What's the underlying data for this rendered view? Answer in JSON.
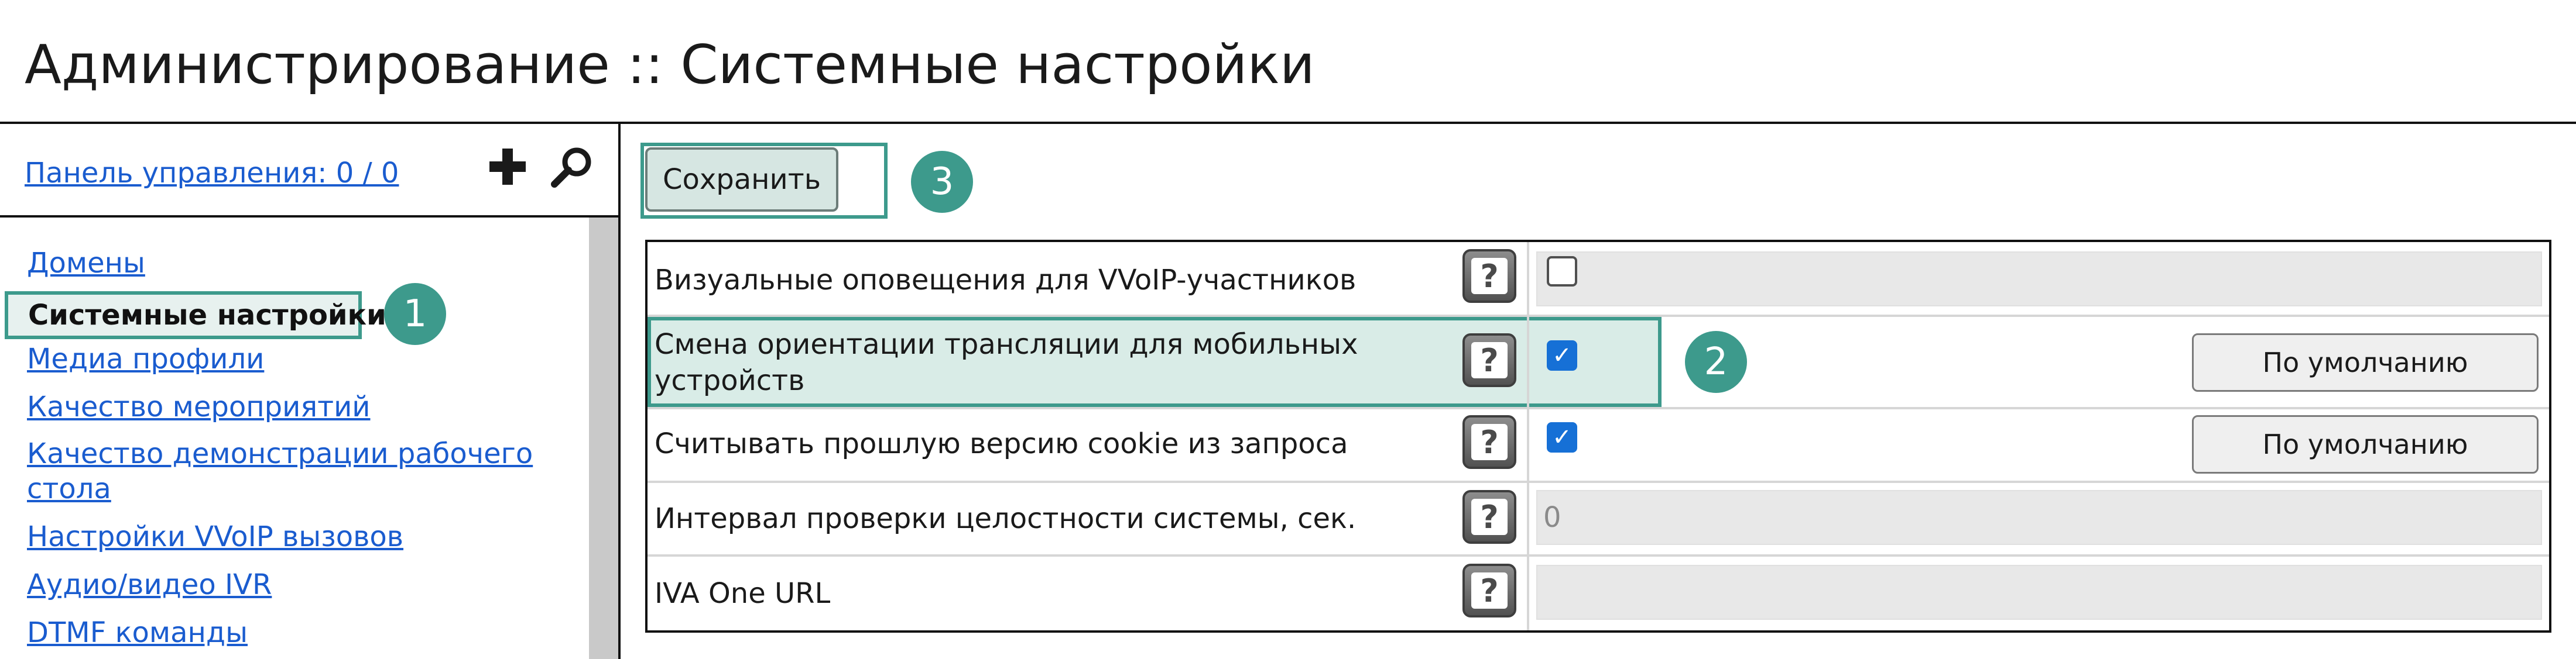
{
  "page": {
    "title": "Администрирование :: Системные настройки"
  },
  "sidebar": {
    "dashboard_link": "Панель управления: 0 / 0",
    "add_icon": "plus-icon",
    "search_icon": "search-icon",
    "items": [
      {
        "label": "Домены",
        "active": false
      },
      {
        "label": "Системные настройки",
        "active": true
      },
      {
        "label": "Медиа профили",
        "active": false
      },
      {
        "label": "Качество мероприятий",
        "active": false
      },
      {
        "label": "Качество демонстрации рабочего стола",
        "line1": "Качество демонстрации рабочего",
        "line2": "стола",
        "active": false
      },
      {
        "label": "Настройки VVoIP вызовов",
        "active": false
      },
      {
        "label": "Аудио/видео IVR",
        "active": false
      },
      {
        "label": "DTMF команды",
        "active": false
      }
    ]
  },
  "toolbar": {
    "save_label": "Сохранить"
  },
  "callouts": {
    "one": "1",
    "two": "2",
    "three": "3"
  },
  "settings": {
    "help_label": "?",
    "default_label": "По умолчанию",
    "rows": [
      {
        "label": "Визуальные оповещения для VVoIP-участников",
        "type": "checkbox",
        "checked": false
      },
      {
        "label": "Смена ориентации трансляции для мобильных устройств",
        "line1": "Смена ориентации трансляции для мобильных",
        "line2": "устройств",
        "type": "checkbox",
        "checked": true,
        "has_default": true
      },
      {
        "label": "Считывать прошлую версию cookie из запроса",
        "type": "checkbox",
        "checked": true,
        "has_default": true
      },
      {
        "label": "Интервал проверки целостности системы, сек.",
        "type": "text",
        "value": "0"
      },
      {
        "label": "IVA One URL",
        "type": "text",
        "value": ""
      }
    ]
  },
  "colors": {
    "accent": "#3d9a8c",
    "link": "#1a5ccf",
    "checkbox": "#1670d6"
  }
}
